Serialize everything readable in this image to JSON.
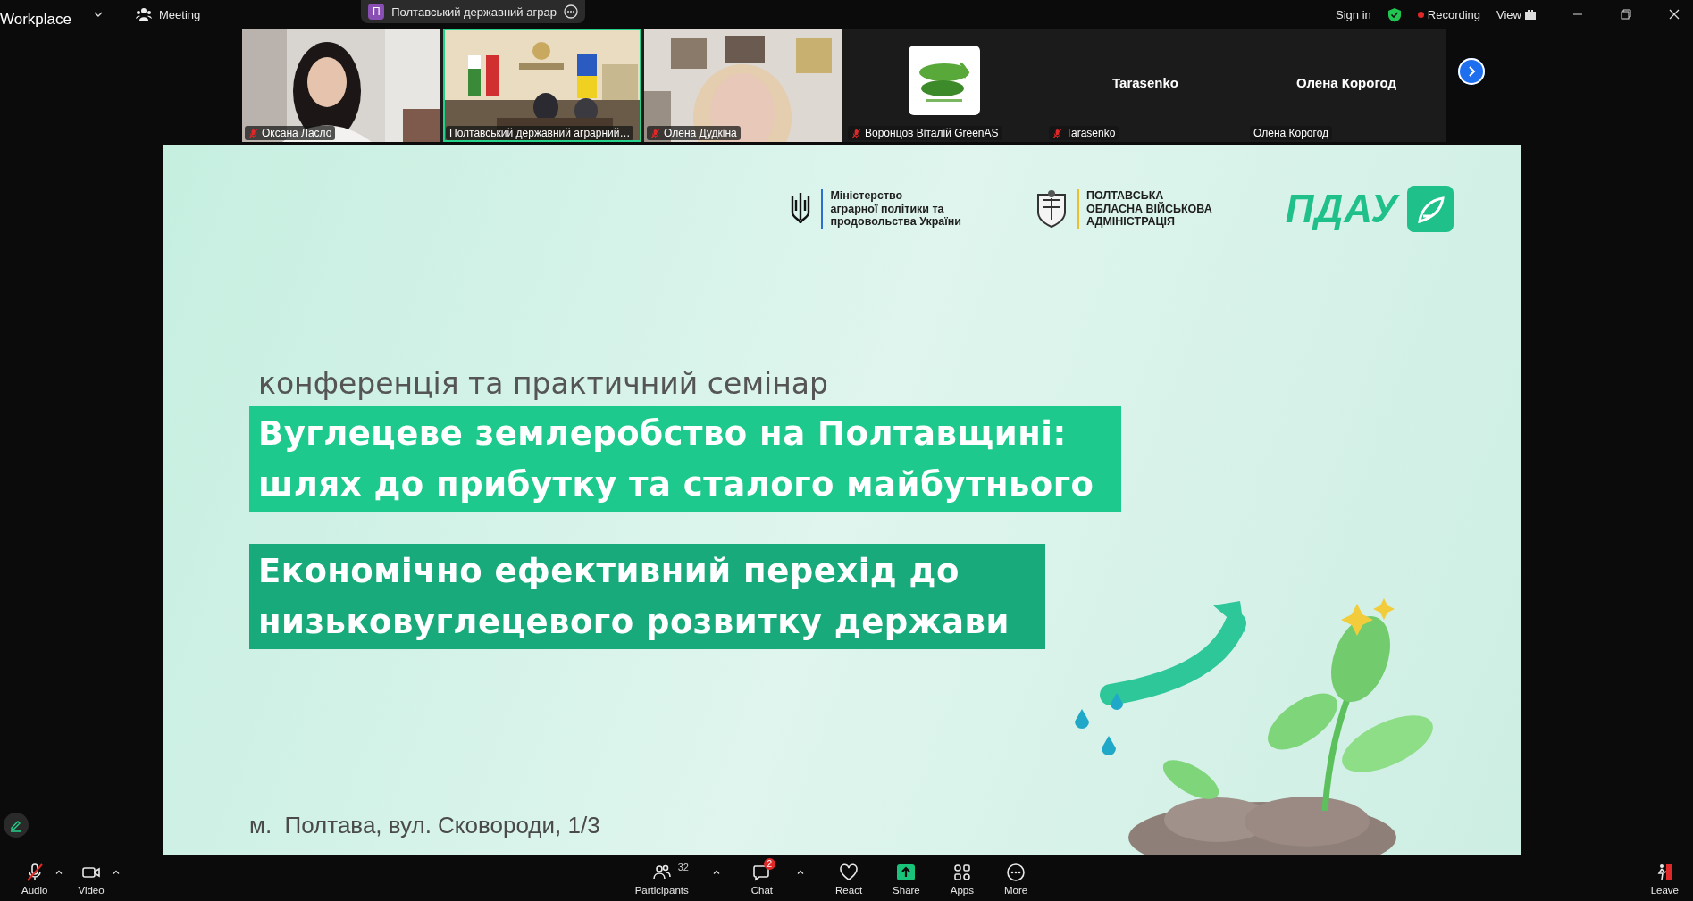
{
  "top_bar": {
    "app_name": "Workplace",
    "meeting_menu": "Meeting",
    "shared_screen": {
      "initial": "П",
      "title": "Полтавський державний аграр"
    },
    "sign_in": "Sign in",
    "recording": "Recording",
    "view": "View"
  },
  "participants": [
    {
      "name": "Оксана Ласло",
      "kind": "video",
      "muted": true,
      "selected": false
    },
    {
      "name": "Полтавський державний аграрний…",
      "kind": "video",
      "muted": false,
      "selected": true
    },
    {
      "name": "Олена Дудкіна",
      "kind": "video",
      "muted": true,
      "selected": false
    },
    {
      "name": "Воронцов Віталій GreenAS",
      "kind": "avatar",
      "muted": true,
      "selected": false
    },
    {
      "name": "Tarasenko",
      "kind": "name",
      "display_name": "Tarasenko",
      "muted": true,
      "selected": false
    },
    {
      "name": "Олена Корогод",
      "kind": "name",
      "display_name": "Олена Корогод",
      "muted": false,
      "selected": false
    }
  ],
  "slide": {
    "logos": [
      {
        "kind": "emblem",
        "lines": [
          "Міністерство",
          "аграрної політики та",
          "продовольства України"
        ]
      },
      {
        "kind": "crest",
        "lines": [
          "ПОЛТАВСЬКА",
          "ОБЛАСНА ВІЙСЬКОВА",
          "АДМІНІСТРАЦІЯ"
        ]
      },
      {
        "kind": "wordmark",
        "lines": [
          "ПДАУ"
        ]
      }
    ],
    "subtitle": "конференція та практичний семінар",
    "headline": [
      "Вуглецеве землеробство на Полтавщині:",
      "шлях до прибутку та сталого майбутнього"
    ],
    "subheadline": [
      "Економічно ефективний перехід до",
      "низьковуглецевого розвитку держави"
    ],
    "address": "м.  Полтава, вул. Сковороди, 1/3"
  },
  "toolbar": [
    {
      "label": "Audio",
      "kind": "audio",
      "muted": true,
      "caret": true
    },
    {
      "label": "Video",
      "kind": "video",
      "caret": true
    },
    {
      "label": "Participants",
      "kind": "participants",
      "count": "32",
      "caret": true
    },
    {
      "label": "Chat",
      "kind": "chat",
      "badge": "2",
      "caret": true
    },
    {
      "label": "React",
      "kind": "react",
      "caret": false
    },
    {
      "label": "Share",
      "kind": "share",
      "caret": false
    },
    {
      "label": "Apps",
      "kind": "apps",
      "caret": false
    },
    {
      "label": "More",
      "kind": "more",
      "caret": false
    },
    {
      "label": "Leave",
      "kind": "leave",
      "caret": false
    }
  ]
}
